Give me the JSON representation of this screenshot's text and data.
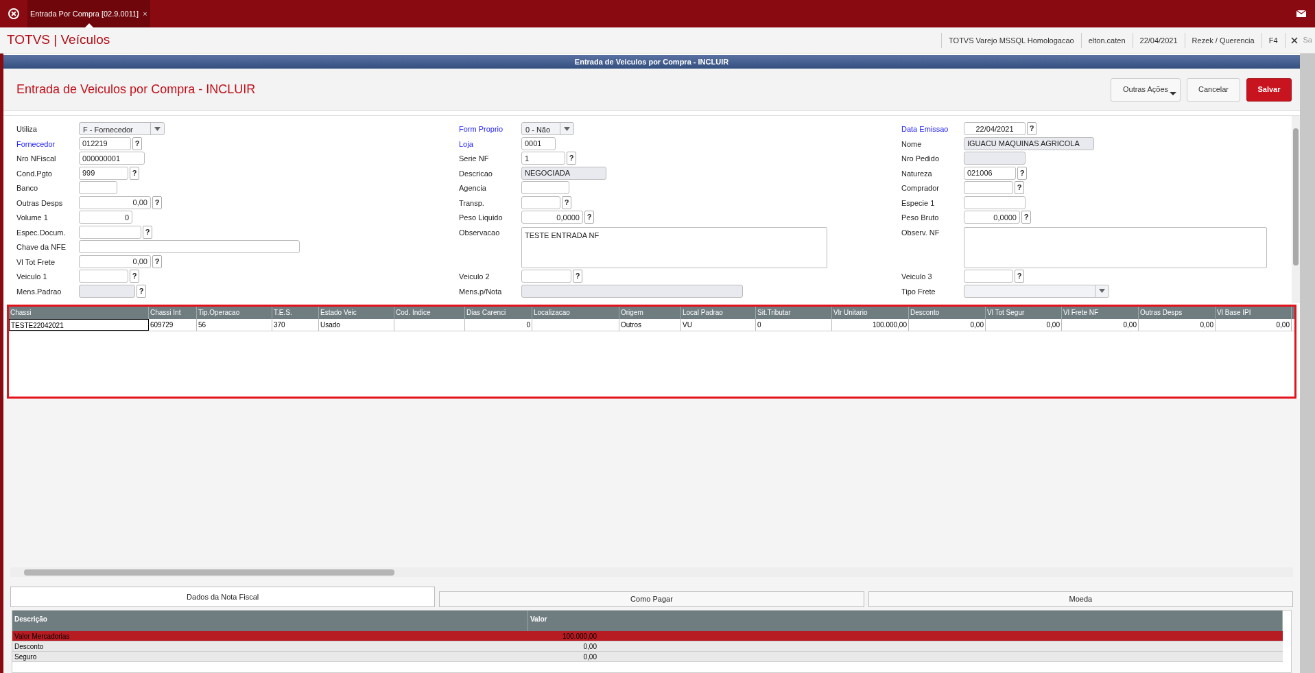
{
  "app_bar": {
    "tab": {
      "label": "Entrada Por Compra [02.9.0011]",
      "close": "×",
      "selected": true
    }
  },
  "header": {
    "brand": "TOTVS | Veículos",
    "info": [
      "TOTVS Varejo MSSQL Homologacao",
      "elton.caten",
      "22/04/2021",
      "Rezek / Querencia",
      "F4"
    ],
    "cut_item": "Sa"
  },
  "window_title": "Entrada de Veiculos por Compra - INCLUIR",
  "page": {
    "title": "Entrada de Veiculos por Compra - INCLUIR",
    "buttons": [
      {
        "label": "Outras Ações",
        "kind": "menu"
      },
      {
        "label": "Cancelar",
        "kind": "plain"
      },
      {
        "label": "Salvar",
        "kind": "primary"
      }
    ]
  },
  "form": {
    "columns": [
      [
        {
          "label": "Utiliza",
          "kind": "select",
          "value": "F - Fornecedor",
          "required": false
        },
        {
          "label": "Fornecedor",
          "kind": "lookup",
          "value": "012219",
          "required": true
        },
        {
          "label": "Nro NFiscal",
          "kind": "text",
          "value": "000000001",
          "required": false
        },
        {
          "label": "Cond.Pgto",
          "kind": "lookup",
          "value": "999",
          "required": false
        },
        {
          "label": "Banco",
          "kind": "text",
          "required": false
        },
        {
          "label": "Outras Desps",
          "kind": "lookup",
          "value": "0,00",
          "required": false
        },
        {
          "label": "Volume 1",
          "kind": "text",
          "value": "0",
          "required": false
        },
        {
          "label": "Espec.Docum.",
          "kind": "lookup",
          "required": false
        },
        {
          "label": "Chave da NFE",
          "kind": "text",
          "required": false
        },
        {
          "label": "Vl Tot Frete",
          "kind": "lookup",
          "value": "0,00",
          "required": false
        },
        {
          "label": "Veiculo 1",
          "kind": "lookup",
          "required": false
        },
        {
          "label": "Mens.Padrao",
          "kind": "readonly_lookup",
          "required": false
        }
      ],
      [
        {
          "label": "Form Proprio",
          "kind": "select",
          "value": "0 - Não",
          "required": true
        },
        {
          "label": "Loja",
          "kind": "text",
          "value": "0001",
          "required": true
        },
        {
          "label": "Serie NF",
          "kind": "lookup",
          "value": "1",
          "required": false
        },
        {
          "label": "Descricao",
          "kind": "readonly",
          "value": "NEGOCIADA",
          "required": false
        },
        {
          "label": "Agencia",
          "kind": "text",
          "required": false
        },
        {
          "label": "Transp.",
          "kind": "lookup",
          "required": false
        },
        {
          "label": "Peso Liquido",
          "kind": "lookup",
          "value": "0,0000",
          "required": false
        },
        {
          "label": "Observacao",
          "kind": "textarea",
          "value": "TESTE ENTRADA NF",
          "required": false
        },
        {
          "label": "Veiculo 2",
          "kind": "lookup",
          "required": false
        },
        {
          "label": "Mens.p/Nota",
          "kind": "readonly",
          "required": false
        }
      ],
      [
        {
          "label": "Data Emissao",
          "kind": "lookup",
          "value": "22/04/2021",
          "required": true
        },
        {
          "label": "Nome",
          "kind": "readonly",
          "value": "IGUACU MAQUINAS AGRICOLA",
          "required": false
        },
        {
          "label": "Nro Pedido",
          "kind": "readonly",
          "required": false
        },
        {
          "label": "Natureza",
          "kind": "lookup",
          "value": "021006",
          "required": false
        },
        {
          "label": "Comprador",
          "kind": "lookup",
          "required": false
        },
        {
          "label": "Especie 1",
          "kind": "text",
          "required": false
        },
        {
          "label": "Peso Bruto",
          "kind": "lookup",
          "value": "0,0000",
          "required": false
        },
        {
          "label": "Observ. NF",
          "kind": "textarea",
          "required": false
        },
        {
          "label": "Veiculo 3",
          "kind": "lookup",
          "required": false
        },
        {
          "label": "Tipo Frete",
          "kind": "select",
          "required": false
        }
      ]
    ],
    "lookup_button": "?"
  },
  "grid": {
    "columns": [
      "Chassi",
      "Chassi Int",
      "Tip.Operacao",
      "T.E.S.",
      "Estado Veic",
      "Cod. Indice",
      "Dias Carenci",
      "Localizacao",
      "Origem",
      "Local Padrao",
      "Sit.Tributar",
      "Vlr Unitario",
      "Desconto",
      "Vl Tot Segur",
      "Vl Frete NF",
      "Outras Desps",
      "Vl Base IPI"
    ],
    "rows": [
      {
        "cells": [
          "TESTE22042021",
          "609729",
          "56",
          "370",
          "Usado",
          "",
          "0",
          "",
          "Outros",
          "VU",
          "0",
          "100.000,00",
          "0,00",
          "0,00",
          "0,00",
          "0,00",
          "0,00"
        ],
        "selected": false
      }
    ]
  },
  "bottom_tabs": [
    {
      "label": "Dados da Nota Fiscal",
      "selected": true
    },
    {
      "label": "Como Pagar",
      "selected": false
    },
    {
      "label": "Moeda",
      "selected": false
    }
  ],
  "totals": {
    "columns": [
      "Descrição",
      "Valor"
    ],
    "rows": [
      {
        "label": "Valor Mercadorias",
        "value": "100.000,00",
        "selected": true
      },
      {
        "label": "Desconto",
        "value": "0,00",
        "selected": false
      },
      {
        "label": "Seguro",
        "value": "0,00",
        "selected": false
      }
    ]
  }
}
